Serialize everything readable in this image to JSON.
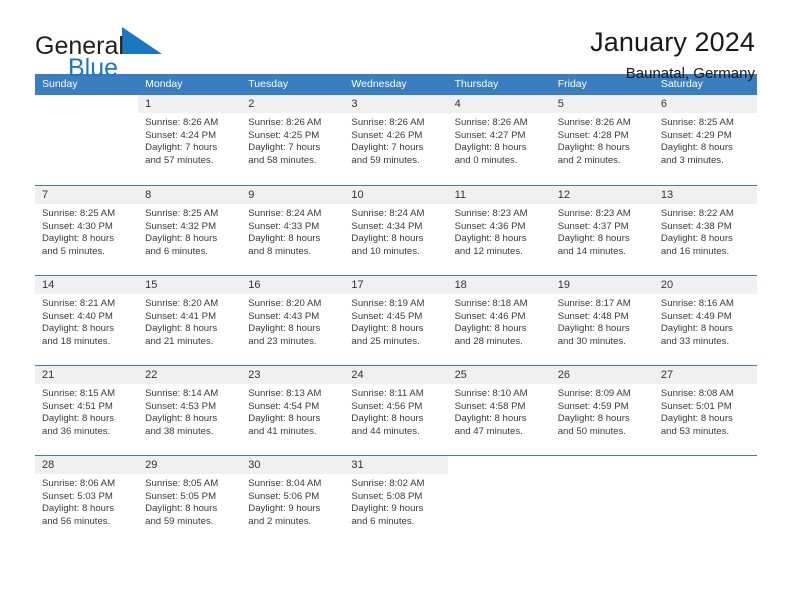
{
  "brand": {
    "name_part1": "General",
    "name_part2": "Blue",
    "triangle_color": "#1c77c3",
    "text_color": "#231f20"
  },
  "header": {
    "title": "January 2024",
    "subtitle": "Baunatal, Germany"
  },
  "theme": {
    "header_blue": "#3b7ebf",
    "daynum_band": "#f0f0f0",
    "text": "#3a3a3a"
  },
  "weekday_headers": [
    "Sunday",
    "Monday",
    "Tuesday",
    "Wednesday",
    "Thursday",
    "Friday",
    "Saturday"
  ],
  "weeks": [
    [
      {
        "day": "",
        "lines": []
      },
      {
        "day": "1",
        "lines": [
          "Sunrise: 8:26 AM",
          "Sunset: 4:24 PM",
          "Daylight: 7 hours",
          "and 57 minutes."
        ]
      },
      {
        "day": "2",
        "lines": [
          "Sunrise: 8:26 AM",
          "Sunset: 4:25 PM",
          "Daylight: 7 hours",
          "and 58 minutes."
        ]
      },
      {
        "day": "3",
        "lines": [
          "Sunrise: 8:26 AM",
          "Sunset: 4:26 PM",
          "Daylight: 7 hours",
          "and 59 minutes."
        ]
      },
      {
        "day": "4",
        "lines": [
          "Sunrise: 8:26 AM",
          "Sunset: 4:27 PM",
          "Daylight: 8 hours",
          "and 0 minutes."
        ]
      },
      {
        "day": "5",
        "lines": [
          "Sunrise: 8:26 AM",
          "Sunset: 4:28 PM",
          "Daylight: 8 hours",
          "and 2 minutes."
        ]
      },
      {
        "day": "6",
        "lines": [
          "Sunrise: 8:25 AM",
          "Sunset: 4:29 PM",
          "Daylight: 8 hours",
          "and 3 minutes."
        ]
      }
    ],
    [
      {
        "day": "7",
        "lines": [
          "Sunrise: 8:25 AM",
          "Sunset: 4:30 PM",
          "Daylight: 8 hours",
          "and 5 minutes."
        ]
      },
      {
        "day": "8",
        "lines": [
          "Sunrise: 8:25 AM",
          "Sunset: 4:32 PM",
          "Daylight: 8 hours",
          "and 6 minutes."
        ]
      },
      {
        "day": "9",
        "lines": [
          "Sunrise: 8:24 AM",
          "Sunset: 4:33 PM",
          "Daylight: 8 hours",
          "and 8 minutes."
        ]
      },
      {
        "day": "10",
        "lines": [
          "Sunrise: 8:24 AM",
          "Sunset: 4:34 PM",
          "Daylight: 8 hours",
          "and 10 minutes."
        ]
      },
      {
        "day": "11",
        "lines": [
          "Sunrise: 8:23 AM",
          "Sunset: 4:36 PM",
          "Daylight: 8 hours",
          "and 12 minutes."
        ]
      },
      {
        "day": "12",
        "lines": [
          "Sunrise: 8:23 AM",
          "Sunset: 4:37 PM",
          "Daylight: 8 hours",
          "and 14 minutes."
        ]
      },
      {
        "day": "13",
        "lines": [
          "Sunrise: 8:22 AM",
          "Sunset: 4:38 PM",
          "Daylight: 8 hours",
          "and 16 minutes."
        ]
      }
    ],
    [
      {
        "day": "14",
        "lines": [
          "Sunrise: 8:21 AM",
          "Sunset: 4:40 PM",
          "Daylight: 8 hours",
          "and 18 minutes."
        ]
      },
      {
        "day": "15",
        "lines": [
          "Sunrise: 8:20 AM",
          "Sunset: 4:41 PM",
          "Daylight: 8 hours",
          "and 21 minutes."
        ]
      },
      {
        "day": "16",
        "lines": [
          "Sunrise: 8:20 AM",
          "Sunset: 4:43 PM",
          "Daylight: 8 hours",
          "and 23 minutes."
        ]
      },
      {
        "day": "17",
        "lines": [
          "Sunrise: 8:19 AM",
          "Sunset: 4:45 PM",
          "Daylight: 8 hours",
          "and 25 minutes."
        ]
      },
      {
        "day": "18",
        "lines": [
          "Sunrise: 8:18 AM",
          "Sunset: 4:46 PM",
          "Daylight: 8 hours",
          "and 28 minutes."
        ]
      },
      {
        "day": "19",
        "lines": [
          "Sunrise: 8:17 AM",
          "Sunset: 4:48 PM",
          "Daylight: 8 hours",
          "and 30 minutes."
        ]
      },
      {
        "day": "20",
        "lines": [
          "Sunrise: 8:16 AM",
          "Sunset: 4:49 PM",
          "Daylight: 8 hours",
          "and 33 minutes."
        ]
      }
    ],
    [
      {
        "day": "21",
        "lines": [
          "Sunrise: 8:15 AM",
          "Sunset: 4:51 PM",
          "Daylight: 8 hours",
          "and 36 minutes."
        ]
      },
      {
        "day": "22",
        "lines": [
          "Sunrise: 8:14 AM",
          "Sunset: 4:53 PM",
          "Daylight: 8 hours",
          "and 38 minutes."
        ]
      },
      {
        "day": "23",
        "lines": [
          "Sunrise: 8:13 AM",
          "Sunset: 4:54 PM",
          "Daylight: 8 hours",
          "and 41 minutes."
        ]
      },
      {
        "day": "24",
        "lines": [
          "Sunrise: 8:11 AM",
          "Sunset: 4:56 PM",
          "Daylight: 8 hours",
          "and 44 minutes."
        ]
      },
      {
        "day": "25",
        "lines": [
          "Sunrise: 8:10 AM",
          "Sunset: 4:58 PM",
          "Daylight: 8 hours",
          "and 47 minutes."
        ]
      },
      {
        "day": "26",
        "lines": [
          "Sunrise: 8:09 AM",
          "Sunset: 4:59 PM",
          "Daylight: 8 hours",
          "and 50 minutes."
        ]
      },
      {
        "day": "27",
        "lines": [
          "Sunrise: 8:08 AM",
          "Sunset: 5:01 PM",
          "Daylight: 8 hours",
          "and 53 minutes."
        ]
      }
    ],
    [
      {
        "day": "28",
        "lines": [
          "Sunrise: 8:06 AM",
          "Sunset: 5:03 PM",
          "Daylight: 8 hours",
          "and 56 minutes."
        ]
      },
      {
        "day": "29",
        "lines": [
          "Sunrise: 8:05 AM",
          "Sunset: 5:05 PM",
          "Daylight: 8 hours",
          "and 59 minutes."
        ]
      },
      {
        "day": "30",
        "lines": [
          "Sunrise: 8:04 AM",
          "Sunset: 5:06 PM",
          "Daylight: 9 hours",
          "and 2 minutes."
        ]
      },
      {
        "day": "31",
        "lines": [
          "Sunrise: 8:02 AM",
          "Sunset: 5:08 PM",
          "Daylight: 9 hours",
          "and 6 minutes."
        ]
      },
      {
        "day": "",
        "lines": []
      },
      {
        "day": "",
        "lines": []
      },
      {
        "day": "",
        "lines": []
      }
    ]
  ]
}
